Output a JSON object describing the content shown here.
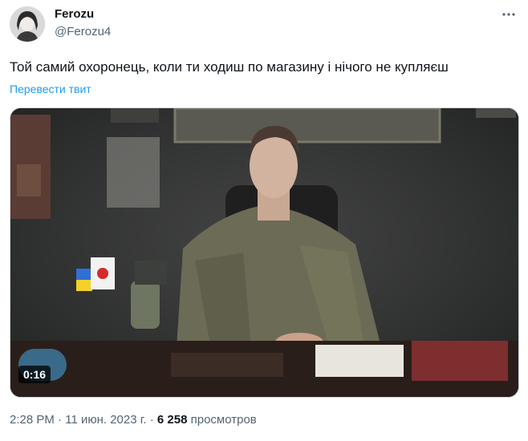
{
  "author": {
    "display_name": "Ferozu",
    "handle": "@Ferozu4"
  },
  "tweet": {
    "text": "Той самий охоронець, коли ти ходиш по магазину і нічого не купляєш",
    "translate_label": "Перевести твит"
  },
  "media": {
    "type": "video",
    "duration": "0:16"
  },
  "meta": {
    "time": "2:28 PM",
    "separator": "·",
    "date": "11 июн. 2023 г.",
    "views_count": "6 258",
    "views_label": "просмотров"
  },
  "colors": {
    "link": "#1d9bf0",
    "secondary_text": "#536471",
    "primary_text": "#0f1419"
  },
  "icons": {
    "more": "more-horizontal-icon"
  }
}
